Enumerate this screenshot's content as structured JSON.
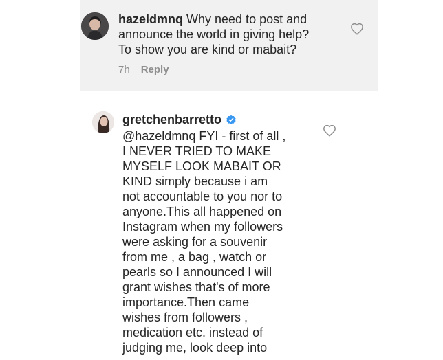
{
  "comment1": {
    "username": "hazeldmnq",
    "lines": [
      " Why need to post and",
      "announce the world in giving help?",
      "To show you are kind or mabait?"
    ],
    "time": "7h",
    "reply_label": "Reply"
  },
  "comment2": {
    "username": "gretchenbarretto",
    "lines": [
      "@hazeldmnq FYI - first of all ,",
      "I NEVER TRIED TO MAKE",
      "MYSELF LOOK MABAIT OR",
      "KIND simply because i am",
      "not accountable to you nor to",
      "anyone.This all happened on",
      "Instagram when my followers",
      "were asking for a souvenir",
      "from me , a bag , watch or",
      "pearls so I announced I will",
      "grant wishes that's of more",
      "importance.Then came",
      "wishes from followers ,",
      "medication etc. instead of",
      "judging me, look deep into"
    ]
  },
  "icons": {
    "heart": "heart-icon",
    "verified": "verified-badge-icon"
  },
  "colors": {
    "text": "#262626",
    "meta": "#8e8e8e",
    "verified": "#3897f0",
    "panel": "#f1f1f1"
  }
}
